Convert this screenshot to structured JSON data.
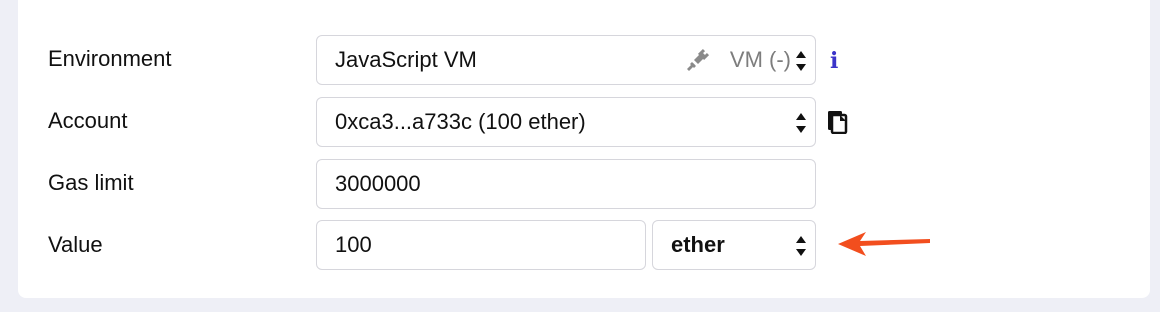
{
  "environment": {
    "label": "Environment",
    "value": "JavaScript VM",
    "note": "VM (-)",
    "note_icon": "plug-icon",
    "info_icon": "info-icon",
    "info_glyph": "i"
  },
  "account": {
    "label": "Account",
    "value": "0xca3...a733c (100 ether)",
    "copy_icon": "clipboard-icon"
  },
  "gas_limit": {
    "label": "Gas limit",
    "value": "3000000"
  },
  "value": {
    "label": "Value",
    "amount": "100",
    "unit": "ether"
  },
  "annotation": {
    "arrow_color": "#f24e1e",
    "points_to": "value-unit-select"
  },
  "colors": {
    "background": "#eeeff6",
    "panel": "#ffffff",
    "field_border": "#d6d6dc",
    "info_icon": "#3b34c9",
    "muted_text": "#7d7d7d"
  }
}
